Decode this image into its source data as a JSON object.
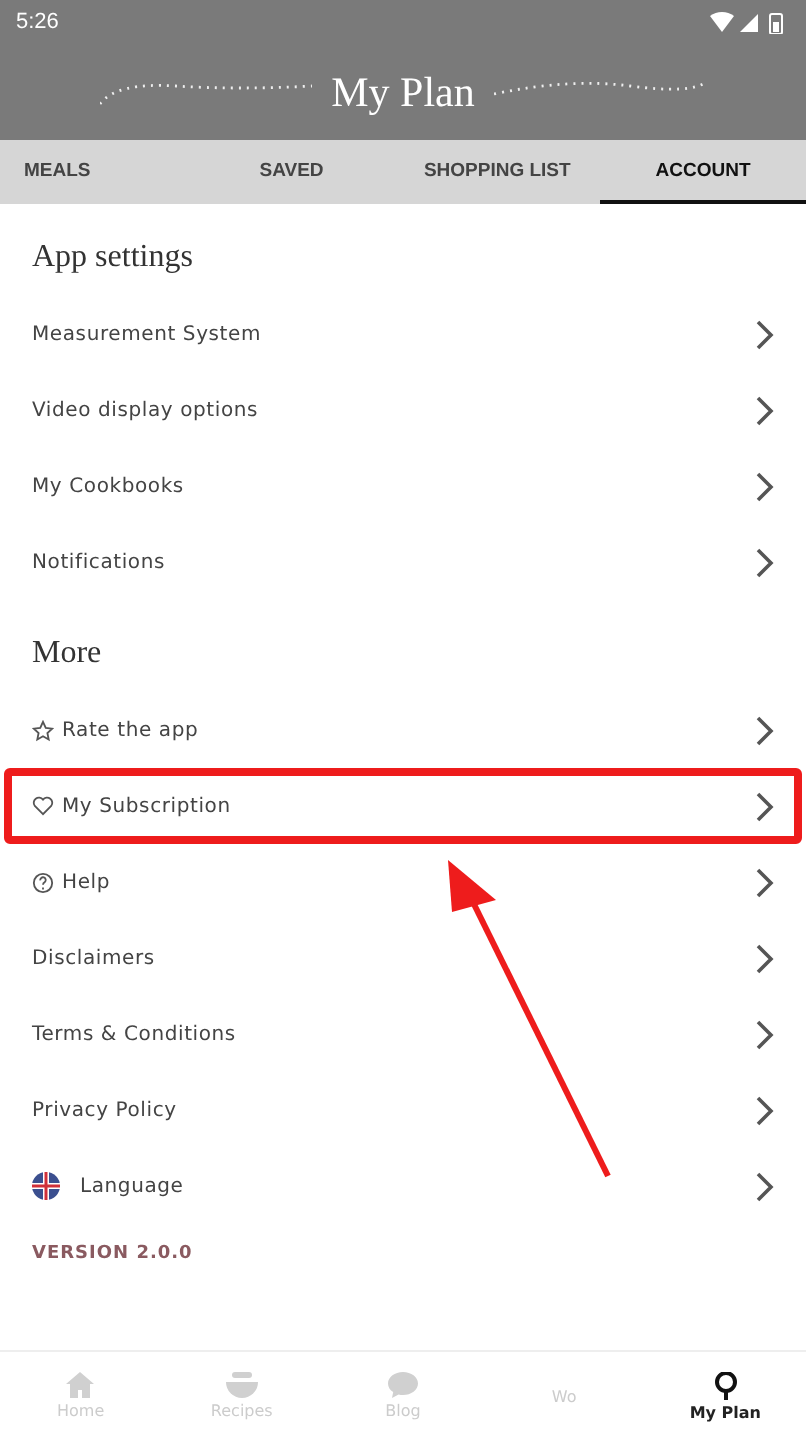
{
  "status_bar": {
    "time": "5:26"
  },
  "header": {
    "title": "My Plan"
  },
  "tabs": [
    {
      "label": "MEALS",
      "selected": false
    },
    {
      "label": "SAVED",
      "selected": false
    },
    {
      "label": "SHOPPING LIST",
      "selected": false
    },
    {
      "label": "ACCOUNT",
      "selected": true
    }
  ],
  "sections": [
    {
      "title": "App settings",
      "items": [
        {
          "label": "Measurement System",
          "kind": "plain",
          "highlighted": false
        },
        {
          "label": "Video display options",
          "kind": "plain",
          "highlighted": false
        },
        {
          "label": "My Cookbooks",
          "kind": "plain",
          "highlighted": false
        },
        {
          "label": "Notifications",
          "kind": "plain",
          "highlighted": false
        }
      ]
    },
    {
      "title": "More",
      "items": [
        {
          "label": "Rate the app",
          "kind": "star",
          "highlighted": false
        },
        {
          "label": "My Subscription",
          "kind": "heart",
          "highlighted": true
        },
        {
          "label": "Help",
          "kind": "help",
          "highlighted": false
        },
        {
          "label": "Disclaimers",
          "kind": "plain",
          "highlighted": false
        },
        {
          "label": "Terms & Conditions",
          "kind": "plain",
          "highlighted": false
        },
        {
          "label": "Privacy Policy",
          "kind": "plain",
          "highlighted": false
        },
        {
          "label": "Language",
          "kind": "flag",
          "highlighted": false
        }
      ]
    }
  ],
  "version": "VERSION 2.0.0",
  "bottom_nav": [
    {
      "label": "Home",
      "kind": "home",
      "selected": false
    },
    {
      "label": "Recipes",
      "kind": "bowl",
      "selected": false
    },
    {
      "label": "Blog",
      "kind": "chat",
      "selected": false
    },
    {
      "label": "Wo",
      "kind": "plain",
      "selected": false
    },
    {
      "label": "My Plan",
      "kind": "pin",
      "selected": true
    }
  ]
}
